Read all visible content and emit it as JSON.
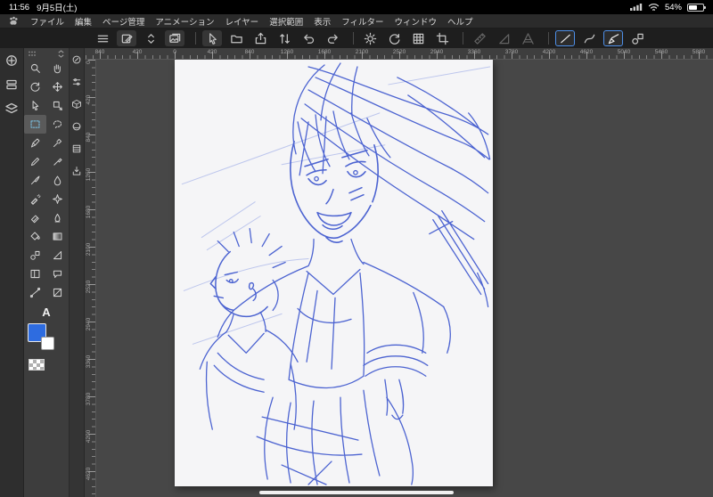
{
  "status_bar": {
    "time": "11:56",
    "date": "9月5日(土)",
    "battery_percent": "54%"
  },
  "menu_bar": {
    "items": [
      "ファイル",
      "編集",
      "ページ管理",
      "アニメーション",
      "レイヤー",
      "選択範囲",
      "表示",
      "フィルター",
      "ウィンドウ",
      "ヘルプ"
    ]
  },
  "toolbar": {
    "icons": [
      "menu",
      "canvas-edit",
      "page-flip",
      "gallery",
      "touch-pointer",
      "open-file",
      "share-export",
      "reorder",
      "undo",
      "redo",
      "brightness-settings",
      "rotate-reset",
      "grid",
      "trim-crop",
      "snap-ruler",
      "snap-special-ruler",
      "snap-grid",
      "line-straight",
      "line-curve",
      "line-polyline",
      "figure-shapes"
    ],
    "active_icons": [
      "line-straight",
      "line-polyline"
    ],
    "disabled_icons": [
      "snap-ruler",
      "snap-special-ruler",
      "snap-grid"
    ]
  },
  "left_dock": {
    "icons": [
      "workspace-circle",
      "palette-dock",
      "layer-dock"
    ]
  },
  "sub_tool_bar": {
    "icons": [
      "navigator",
      "tool-property",
      "cube-3d",
      "sphere-material",
      "material-stack",
      "material-download"
    ]
  },
  "tool_palette": {
    "tools": [
      "zoom",
      "hand",
      "rotate-canvas",
      "move-layer",
      "operate-object",
      "select-object",
      "marquee",
      "lasso",
      "pen",
      "eyedropper",
      "pencil",
      "marker",
      "brush",
      "watercolor",
      "airbrush",
      "decoration",
      "eraser",
      "blend",
      "fill",
      "gradient",
      "figure",
      "ruler",
      "frame-border",
      "balloon",
      "line-correction",
      "panel"
    ],
    "selected_tool": "marquee",
    "text_tool_label": "A"
  },
  "colors": {
    "main": "#2e6ce0",
    "sub": "#ffffff",
    "sketch": "#3550cc",
    "construction": "#7b8de0"
  },
  "rulers": {
    "horizontal": [
      "840",
      "420",
      "0",
      "420",
      "840",
      "1260",
      "1680",
      "2100",
      "2520",
      "2940",
      "3360",
      "3780",
      "4200",
      "4620",
      "5040",
      "5460",
      "5880"
    ],
    "vertical": [
      "0",
      "420",
      "840",
      "1260",
      "1680",
      "2100",
      "2520",
      "2940",
      "3360",
      "3780",
      "4200",
      "4620"
    ]
  }
}
